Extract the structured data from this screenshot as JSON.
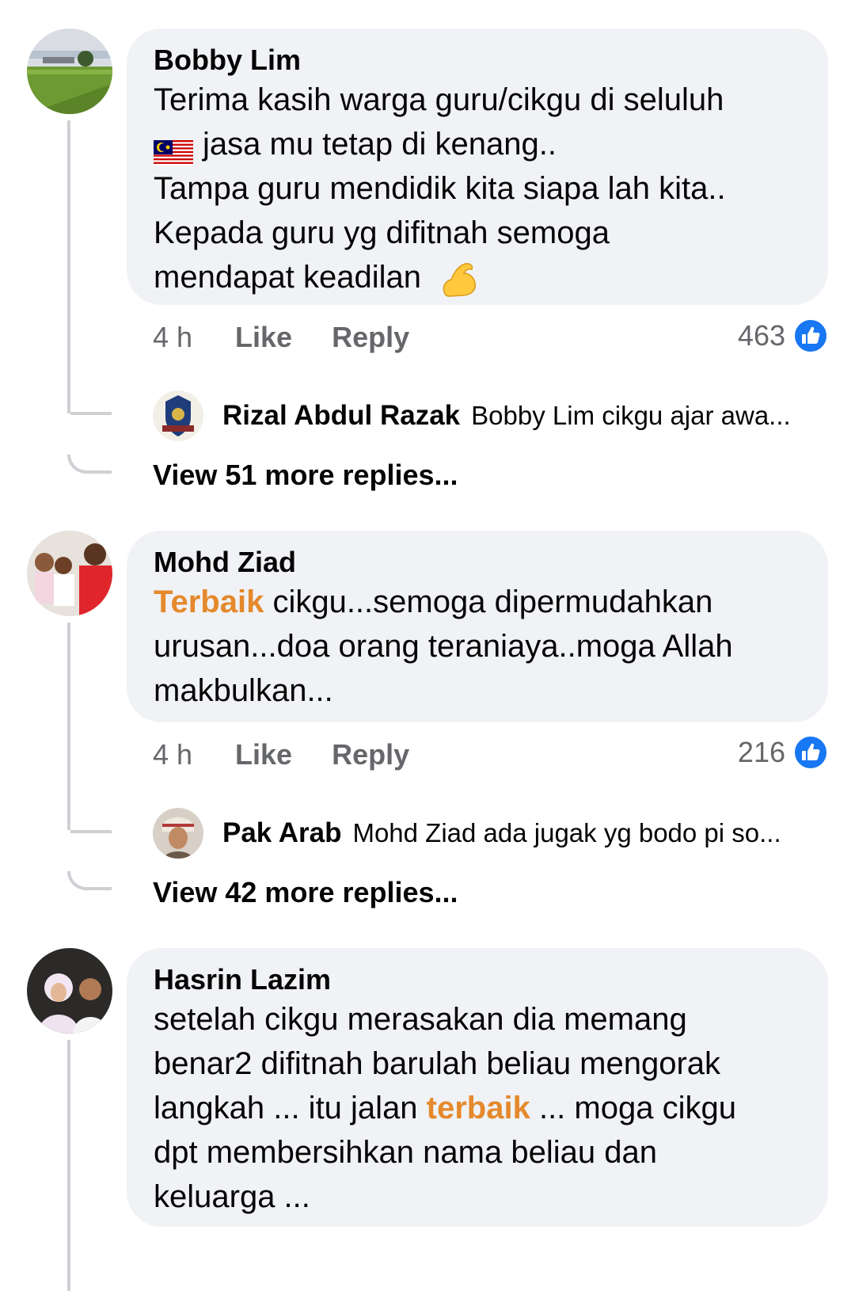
{
  "comments": [
    {
      "author": "Bobby Lim",
      "lines": [
        "Terima kasih warga guru/cikgu di seluluh",
        "jasa mu tetap di kenang..",
        "Tampa guru mendidik kita siapa lah kita..",
        "Kepada guru yg difitnah semoga",
        "mendapat keadilan"
      ],
      "flag_emoji": "🇲🇾",
      "end_emoji": "💪",
      "time": "4 h",
      "like_label": "Like",
      "reply_label": "Reply",
      "reaction_count": "463",
      "reply_preview": {
        "name": "Rizal Abdul Razak",
        "text": "Bobby Lim cikgu ajar awa..."
      },
      "view_more": "View 51 more replies..."
    },
    {
      "author": "Mohd Ziad",
      "highlight": "Terbaik",
      "lines": [
        " cikgu...semoga dipermudahkan",
        "urusan...doa orang teraniaya..moga Allah",
        "makbulkan..."
      ],
      "time": "4 h",
      "like_label": "Like",
      "reply_label": "Reply",
      "reaction_count": "216",
      "reply_preview": {
        "name": "Pak Arab",
        "text": "Mohd Ziad ada jugak yg bodo pi so..."
      },
      "view_more": "View 42 more replies..."
    },
    {
      "author": "Hasrin Lazim",
      "lines": [
        "setelah cikgu merasakan dia memang",
        "benar2 difitnah barulah beliau mengorak",
        "langkah ... itu jalan ",
        "terbaik",
        " ... moga cikgu",
        "dpt membersihkan nama beliau dan",
        "keluarga ..."
      ]
    }
  ],
  "colors": {
    "bubble": "#f0f2f5",
    "thread_line": "#ced0d4",
    "meta_text": "#65676b",
    "highlight": "#e4892c",
    "like_blue": "#1877f2"
  },
  "icons": [
    "like-reaction-icon",
    "flexed-biceps-emoji",
    "malaysia-flag-emoji"
  ]
}
